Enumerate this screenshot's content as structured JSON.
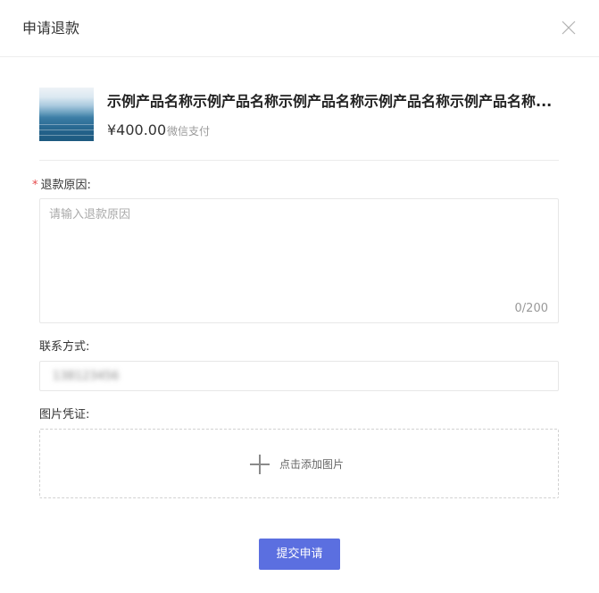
{
  "dialog": {
    "title": "申请退款"
  },
  "product": {
    "name": "示例产品名称示例产品名称示例产品名称示例产品名称示例产品名称...",
    "price": "¥400.00",
    "payment_method": "微信支付"
  },
  "form": {
    "reason": {
      "required_mark": "*",
      "label": "退款原因:",
      "placeholder": "请输入退款原因",
      "counter": "0/200"
    },
    "contact": {
      "label": "联系方式:",
      "value": "138123456"
    },
    "evidence": {
      "label": "图片凭证:",
      "upload_text": "点击添加图片"
    },
    "submit_label": "提交申请"
  },
  "colors": {
    "primary": "#5b6fe0",
    "required": "#e5494b"
  },
  "icons": {
    "close": "close-icon",
    "add": "plus-icon"
  }
}
